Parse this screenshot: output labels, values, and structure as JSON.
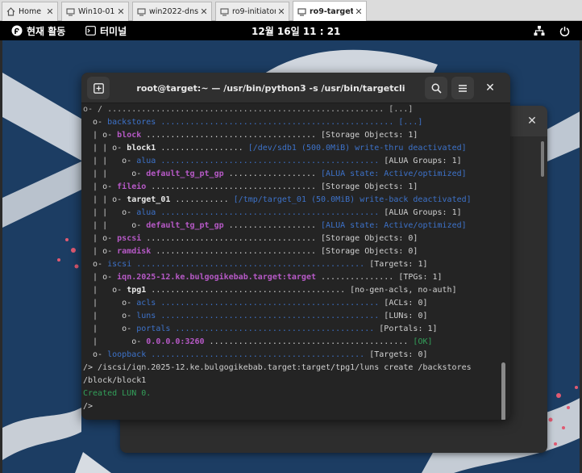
{
  "vm_tabs": [
    {
      "label": "Home",
      "icon": "home-icon",
      "active": false
    },
    {
      "label": "Win10-01",
      "icon": "vm-icon",
      "active": false
    },
    {
      "label": "win2022-dns",
      "icon": "vm-icon",
      "active": false
    },
    {
      "label": "ro9-initiator",
      "icon": "vm-icon",
      "active": false
    },
    {
      "label": "ro9-target",
      "icon": "vm-icon",
      "active": true
    }
  ],
  "topbar": {
    "activities": "현재 활동",
    "app": "터미널",
    "clock": "12월 16일  11 : 21"
  },
  "terminal": {
    "title": "root@target:~ — /usr/bin/python3 -s /usr/bin/targetcli",
    "lines": [
      [
        {
          "t": "o- / ......................................................... [...]",
          "c": "dim"
        }
      ],
      [
        {
          "t": "  o- ",
          "c": "pl"
        },
        {
          "t": "backstores",
          "c": "blue"
        },
        {
          "t": " ................................................ [...]",
          "c": "blue"
        }
      ],
      [
        {
          "t": "  | o- ",
          "c": "pl"
        },
        {
          "t": "block",
          "c": "mag"
        },
        {
          "t": " ................................... [Storage Objects: 1]",
          "c": "pl"
        }
      ],
      [
        {
          "t": "  | | o- ",
          "c": "pl"
        },
        {
          "t": "block1",
          "c": "wht"
        },
        {
          "t": " ................. ",
          "c": "pl"
        },
        {
          "t": "[/dev/sdb1 (500.0MiB) write-thru deactivated]",
          "c": "blue"
        }
      ],
      [
        {
          "t": "  | |   o- ",
          "c": "pl"
        },
        {
          "t": "alua",
          "c": "blue"
        },
        {
          "t": " ............................................. ",
          "c": "blue"
        },
        {
          "t": "[ALUA Groups: 1]",
          "c": "pl"
        }
      ],
      [
        {
          "t": "  | |     o- ",
          "c": "pl"
        },
        {
          "t": "default_tg_pt_gp",
          "c": "mag"
        },
        {
          "t": " .................. ",
          "c": "pl"
        },
        {
          "t": "[ALUA state: Active/optimized]",
          "c": "blue"
        }
      ],
      [
        {
          "t": "  | o- ",
          "c": "pl"
        },
        {
          "t": "fileio",
          "c": "mag"
        },
        {
          "t": " .................................. [Storage Objects: 1]",
          "c": "pl"
        }
      ],
      [
        {
          "t": "  | | o- ",
          "c": "pl"
        },
        {
          "t": "target_01",
          "c": "wht"
        },
        {
          "t": " ........... ",
          "c": "pl"
        },
        {
          "t": "[/tmp/target_01 (50.0MiB) write-back deactivated]",
          "c": "blue"
        }
      ],
      [
        {
          "t": "  | |   o- ",
          "c": "pl"
        },
        {
          "t": "alua",
          "c": "blue"
        },
        {
          "t": " ............................................. ",
          "c": "blue"
        },
        {
          "t": "[ALUA Groups: 1]",
          "c": "pl"
        }
      ],
      [
        {
          "t": "  | |     o- ",
          "c": "pl"
        },
        {
          "t": "default_tg_pt_gp",
          "c": "mag"
        },
        {
          "t": " .................. ",
          "c": "pl"
        },
        {
          "t": "[ALUA state: Active/optimized]",
          "c": "blue"
        }
      ],
      [
        {
          "t": "  | o- ",
          "c": "pl"
        },
        {
          "t": "pscsi",
          "c": "mag"
        },
        {
          "t": " ................................... [Storage Objects: 0]",
          "c": "pl"
        }
      ],
      [
        {
          "t": "  | o- ",
          "c": "pl"
        },
        {
          "t": "ramdisk",
          "c": "mag"
        },
        {
          "t": " ................................. [Storage Objects: 0]",
          "c": "pl"
        }
      ],
      [
        {
          "t": "  o- ",
          "c": "pl"
        },
        {
          "t": "iscsi",
          "c": "blue"
        },
        {
          "t": " ............................................... ",
          "c": "blue"
        },
        {
          "t": "[Targets: 1]",
          "c": "pl"
        }
      ],
      [
        {
          "t": "  | o- ",
          "c": "pl"
        },
        {
          "t": "iqn.2025-12.ke.bulgogikebab.target:target",
          "c": "mag"
        },
        {
          "t": " ............... [TPGs: 1]",
          "c": "pl"
        }
      ],
      [
        {
          "t": "  |   o- ",
          "c": "pl"
        },
        {
          "t": "tpg1",
          "c": "wht"
        },
        {
          "t": " ........................................ [no-gen-acls, no-auth]",
          "c": "pl"
        }
      ],
      [
        {
          "t": "  |     o- ",
          "c": "pl"
        },
        {
          "t": "acls",
          "c": "blue"
        },
        {
          "t": " ............................................. ",
          "c": "blue"
        },
        {
          "t": "[ACLs: 0]",
          "c": "pl"
        }
      ],
      [
        {
          "t": "  |     o- ",
          "c": "pl"
        },
        {
          "t": "luns",
          "c": "blue"
        },
        {
          "t": " ............................................. ",
          "c": "blue"
        },
        {
          "t": "[LUNs: 0]",
          "c": "pl"
        }
      ],
      [
        {
          "t": "  |     o- ",
          "c": "pl"
        },
        {
          "t": "portals",
          "c": "blue"
        },
        {
          "t": " ......................................... ",
          "c": "blue"
        },
        {
          "t": "[Portals: 1]",
          "c": "pl"
        }
      ],
      [
        {
          "t": "  |       o- ",
          "c": "pl"
        },
        {
          "t": "0.0.0.0:3260",
          "c": "mag"
        },
        {
          "t": " ......................................... ",
          "c": "pl"
        },
        {
          "t": "[OK]",
          "c": "grn"
        }
      ],
      [
        {
          "t": "  o- ",
          "c": "pl"
        },
        {
          "t": "loopback",
          "c": "blue"
        },
        {
          "t": " ............................................ ",
          "c": "blue"
        },
        {
          "t": "[Targets: 0]",
          "c": "pl"
        }
      ],
      [
        {
          "t": "/> /iscsi/iqn.2025-12.ke.bulgogikebab.target:target/tpg1/luns create /backstores",
          "c": "pl"
        }
      ],
      [
        {
          "t": "/block/block1",
          "c": "pl"
        }
      ],
      [
        {
          "t": "Created LUN 0.",
          "c": "grn"
        }
      ],
      [
        {
          "t": "/>",
          "c": "pl"
        }
      ]
    ]
  },
  "colors": {
    "desktop_bg": "#1c3d63",
    "terminal_bg": "#242424",
    "blue_text": "#3d72c9",
    "magenta_text": "#b659c6",
    "green_text": "#33a05a"
  },
  "icons": {
    "new_tab": "new-tab-icon",
    "search": "search-icon",
    "menu": "hamburger-menu-icon",
    "close": "close-icon",
    "network": "network-icon",
    "power": "power-icon",
    "fedora_logo": "activities-logo-icon",
    "terminal": "terminal-app-icon"
  }
}
